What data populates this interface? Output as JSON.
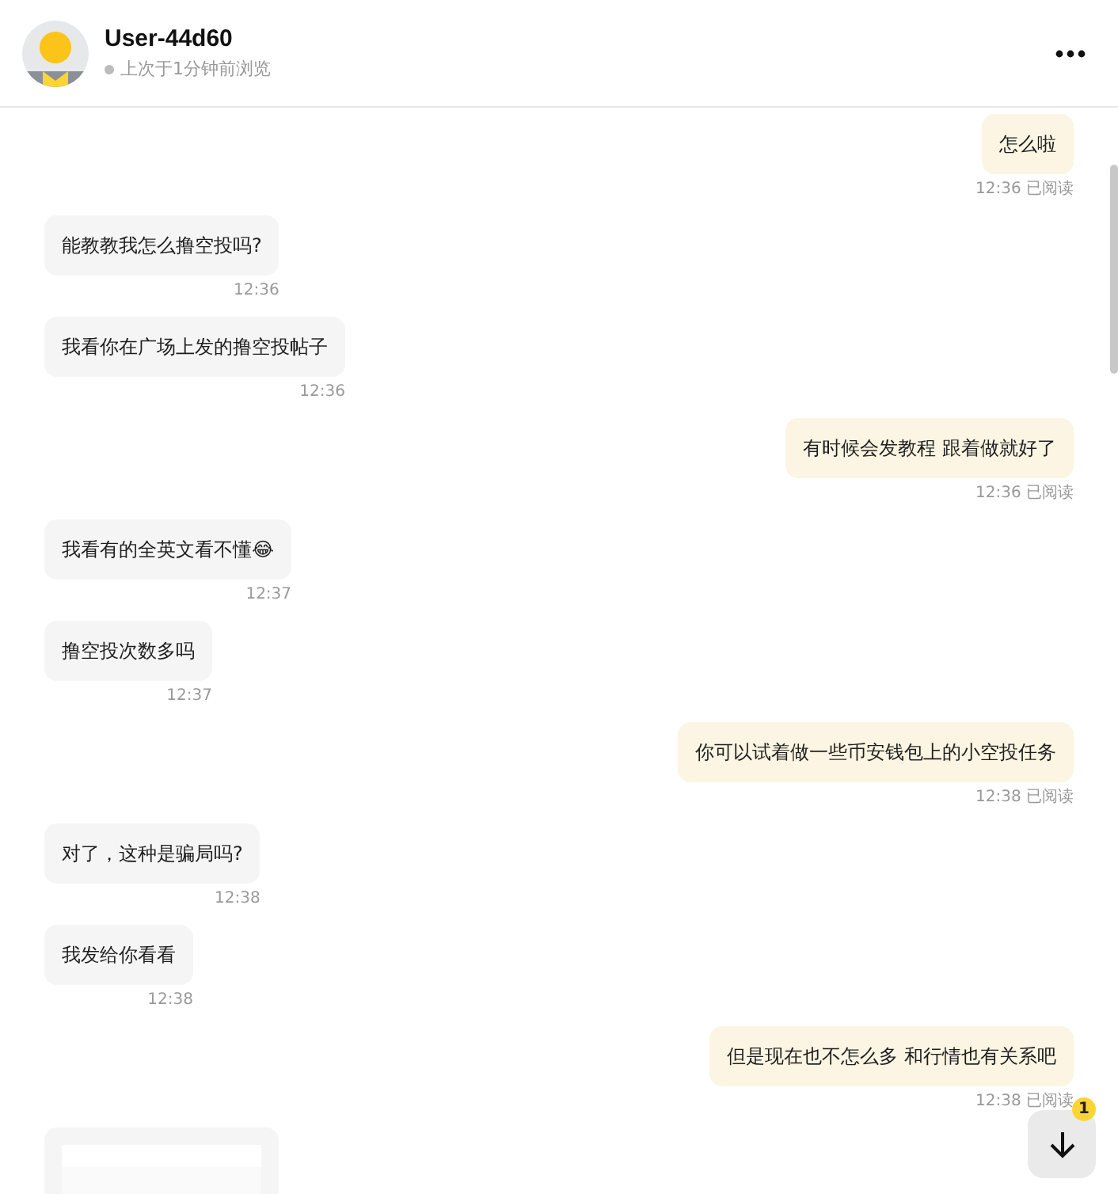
{
  "header": {
    "name": "User-44d60",
    "last_seen": "上次于1分钟前浏览",
    "online": false
  },
  "messages": [
    {
      "outgoing": true,
      "kind": "text",
      "text": "怎么啦",
      "time": "12:36",
      "status": "已阅读"
    },
    {
      "outgoing": false,
      "kind": "text",
      "text": "能教教我怎么撸空投吗?",
      "time": "12:36"
    },
    {
      "outgoing": false,
      "kind": "text",
      "text": "我看你在广场上发的撸空投帖子",
      "time": "12:36"
    },
    {
      "outgoing": true,
      "kind": "text",
      "text": "有时候会发教程 跟着做就好了",
      "time": "12:36",
      "status": "已阅读"
    },
    {
      "outgoing": false,
      "kind": "text",
      "text": "我看有的全英文看不懂😂",
      "time": "12:37"
    },
    {
      "outgoing": false,
      "kind": "text",
      "text": "撸空投次数多吗",
      "time": "12:37"
    },
    {
      "outgoing": true,
      "kind": "text",
      "text": "你可以试着做一些币安钱包上的小空投任务",
      "time": "12:38",
      "status": "已阅读"
    },
    {
      "outgoing": false,
      "kind": "text",
      "text": "对了，这种是骗局吗?",
      "time": "12:38"
    },
    {
      "outgoing": false,
      "kind": "text",
      "text": "我发给你看看",
      "time": "12:38"
    },
    {
      "outgoing": true,
      "kind": "text",
      "text": "但是现在也不怎么多 和行情也有关系吧",
      "time": "12:38",
      "status": "已阅读"
    },
    {
      "outgoing": false,
      "kind": "picture"
    }
  ],
  "scroll_button": {
    "badge": "1"
  }
}
